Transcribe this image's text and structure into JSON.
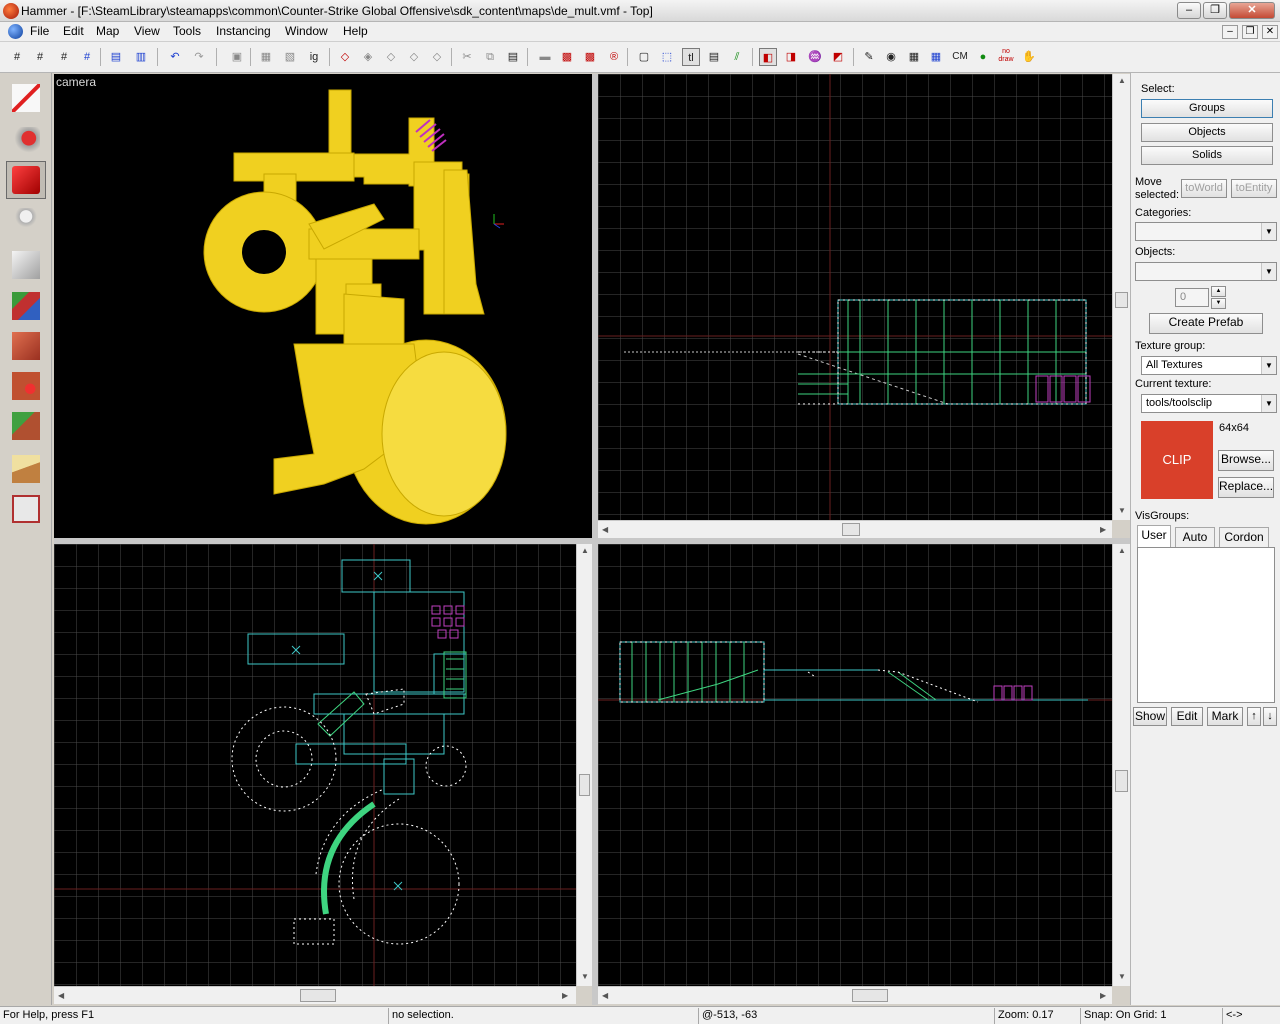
{
  "window": {
    "title": "Hammer - [F:\\SteamLibrary\\steamapps\\common\\Counter-Strike Global Offensive\\sdk_content\\maps\\de_mult.vmf - Top]"
  },
  "menu": [
    "File",
    "Edit",
    "Map",
    "View",
    "Tools",
    "Instancing",
    "Window",
    "Help"
  ],
  "toolbar": {
    "labels": {
      "tl": "tl",
      "cm": "CM",
      "nodraw": "no draw"
    },
    "icons": [
      "grid-icon",
      "grid-smaller-icon",
      "grid-larger-icon",
      "grid-snap-icon",
      "group-icon",
      "ungroup-icon",
      "undo-icon",
      "redo-icon",
      "carve-icon",
      "hollow-icon",
      "clip-icon",
      "texture-lock-icon",
      "cut-icon",
      "copy-icon",
      "paste-icon",
      "cordon-icon",
      "compile-icon"
    ]
  },
  "left_tools": [
    "selection-tool-icon",
    "magnify-tool-icon",
    "camera-tool-icon",
    "entity-tool-icon",
    "block-tool-icon",
    "texture-application-icon",
    "apply-current-texture-icon",
    "decal-tool-icon",
    "overlay-tool-icon",
    "clipping-tool-icon",
    "vertex-tool-icon"
  ],
  "viewports": {
    "camera": {
      "label": "camera"
    }
  },
  "right_panel": {
    "select_label": "Select:",
    "select_buttons": [
      "Groups",
      "Objects",
      "Solids"
    ],
    "move_selected_label": "Move\nselected:",
    "to_world": "toWorld",
    "to_entity": "toEntity",
    "categories_label": "Categories:",
    "objects_label": "Objects:",
    "spinner_value": "0",
    "create_prefab": "Create Prefab",
    "texture_group_label": "Texture group:",
    "texture_group_value": "All Textures",
    "current_texture_label": "Current texture:",
    "current_texture_value": "tools/toolsclip",
    "texture_size": "64x64",
    "texture_preview_text": "CLIP",
    "browse": "Browse...",
    "replace": "Replace...",
    "visgroups_label": "VisGroups:",
    "visgroup_tabs": [
      "User",
      "Auto",
      "Cordon"
    ],
    "visgroup_buttons": [
      "Show",
      "Edit",
      "Mark"
    ]
  },
  "status": {
    "help": "For Help, press F1",
    "selection": "no selection.",
    "coords": "@-513, -63",
    "zoom": "Zoom: 0.17",
    "snap": "Snap: On Grid: 1",
    "arrows": "<->"
  },
  "colors": {
    "viewport_bg": "#000000",
    "grid": "#4a4a4a",
    "brush_cyan": "#3ec8c8",
    "brush_green": "#3ed480",
    "clip_purple": "#c040c0",
    "camera_yellow": "#f0d020",
    "texture_clip": "#d9402a"
  }
}
